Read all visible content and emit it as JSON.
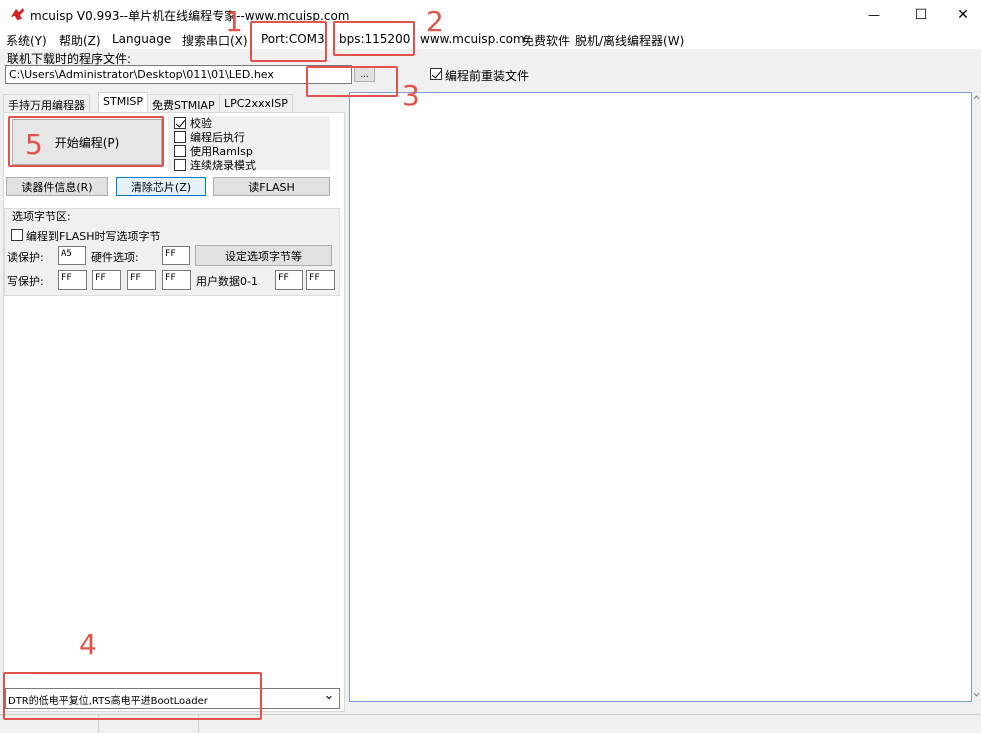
{
  "window": {
    "title": "mcuisp V0.993--单片机在线编程专家--www.mcuisp.com",
    "minimize": "—",
    "maximize": "☐",
    "close": "✕"
  },
  "menu": {
    "system": "系统(Y)",
    "help": "帮助(Z)",
    "language": "Language",
    "search_port": "搜索串口(X)",
    "port": "Port:COM3",
    "bps": "bps:115200",
    "website": "www.mcuisp.com",
    "free_software": "免费软件",
    "offline": "脱机/离线编程器(W)"
  },
  "file": {
    "label": "联机下载时的程序文件:",
    "path": "C:\\Users\\Administrator\\Desktop\\011\\01\\LED.hex",
    "browse": "...",
    "reload_label": "编程前重装文件",
    "reload_checked": true
  },
  "tabs": [
    {
      "label": "手持万用编程器",
      "active": false
    },
    {
      "label": "STMISP",
      "active": true
    },
    {
      "label": "免费STMIAP",
      "active": false
    },
    {
      "label": "LPC2xxxISP",
      "active": false
    }
  ],
  "stmisp": {
    "start_button": "开始编程(P)",
    "options": [
      {
        "label": "校验",
        "checked": true
      },
      {
        "label": "编程后执行",
        "checked": false
      },
      {
        "label": "使用RamIsp",
        "checked": false
      },
      {
        "label": "连续烧录模式",
        "checked": false
      }
    ],
    "read_info": "读器件信息(R)",
    "erase_chip": "清除芯片(Z)",
    "read_flash": "读FLASH",
    "option_group": "选项字节区:",
    "write_option_label": "编程到FLASH时写选项字节",
    "read_protect_label": "读保护:",
    "read_protect_value": "A5",
    "hw_option_label": "硬件选项:",
    "hw_option_value": "FF",
    "set_option_button": "设定选项字节等",
    "write_protect_label": "写保护:",
    "write_protect_values": [
      "FF",
      "FF",
      "FF",
      "FF"
    ],
    "user_data_label": "用户数据0-1",
    "user_data_values": [
      "FF",
      "FF"
    ]
  },
  "boot_select": {
    "value": "DTR的低电平复位,RTS高电平进BootLoader",
    "arrow": "⌄"
  },
  "annotations": [
    "1",
    "2",
    "3",
    "4",
    "5"
  ]
}
